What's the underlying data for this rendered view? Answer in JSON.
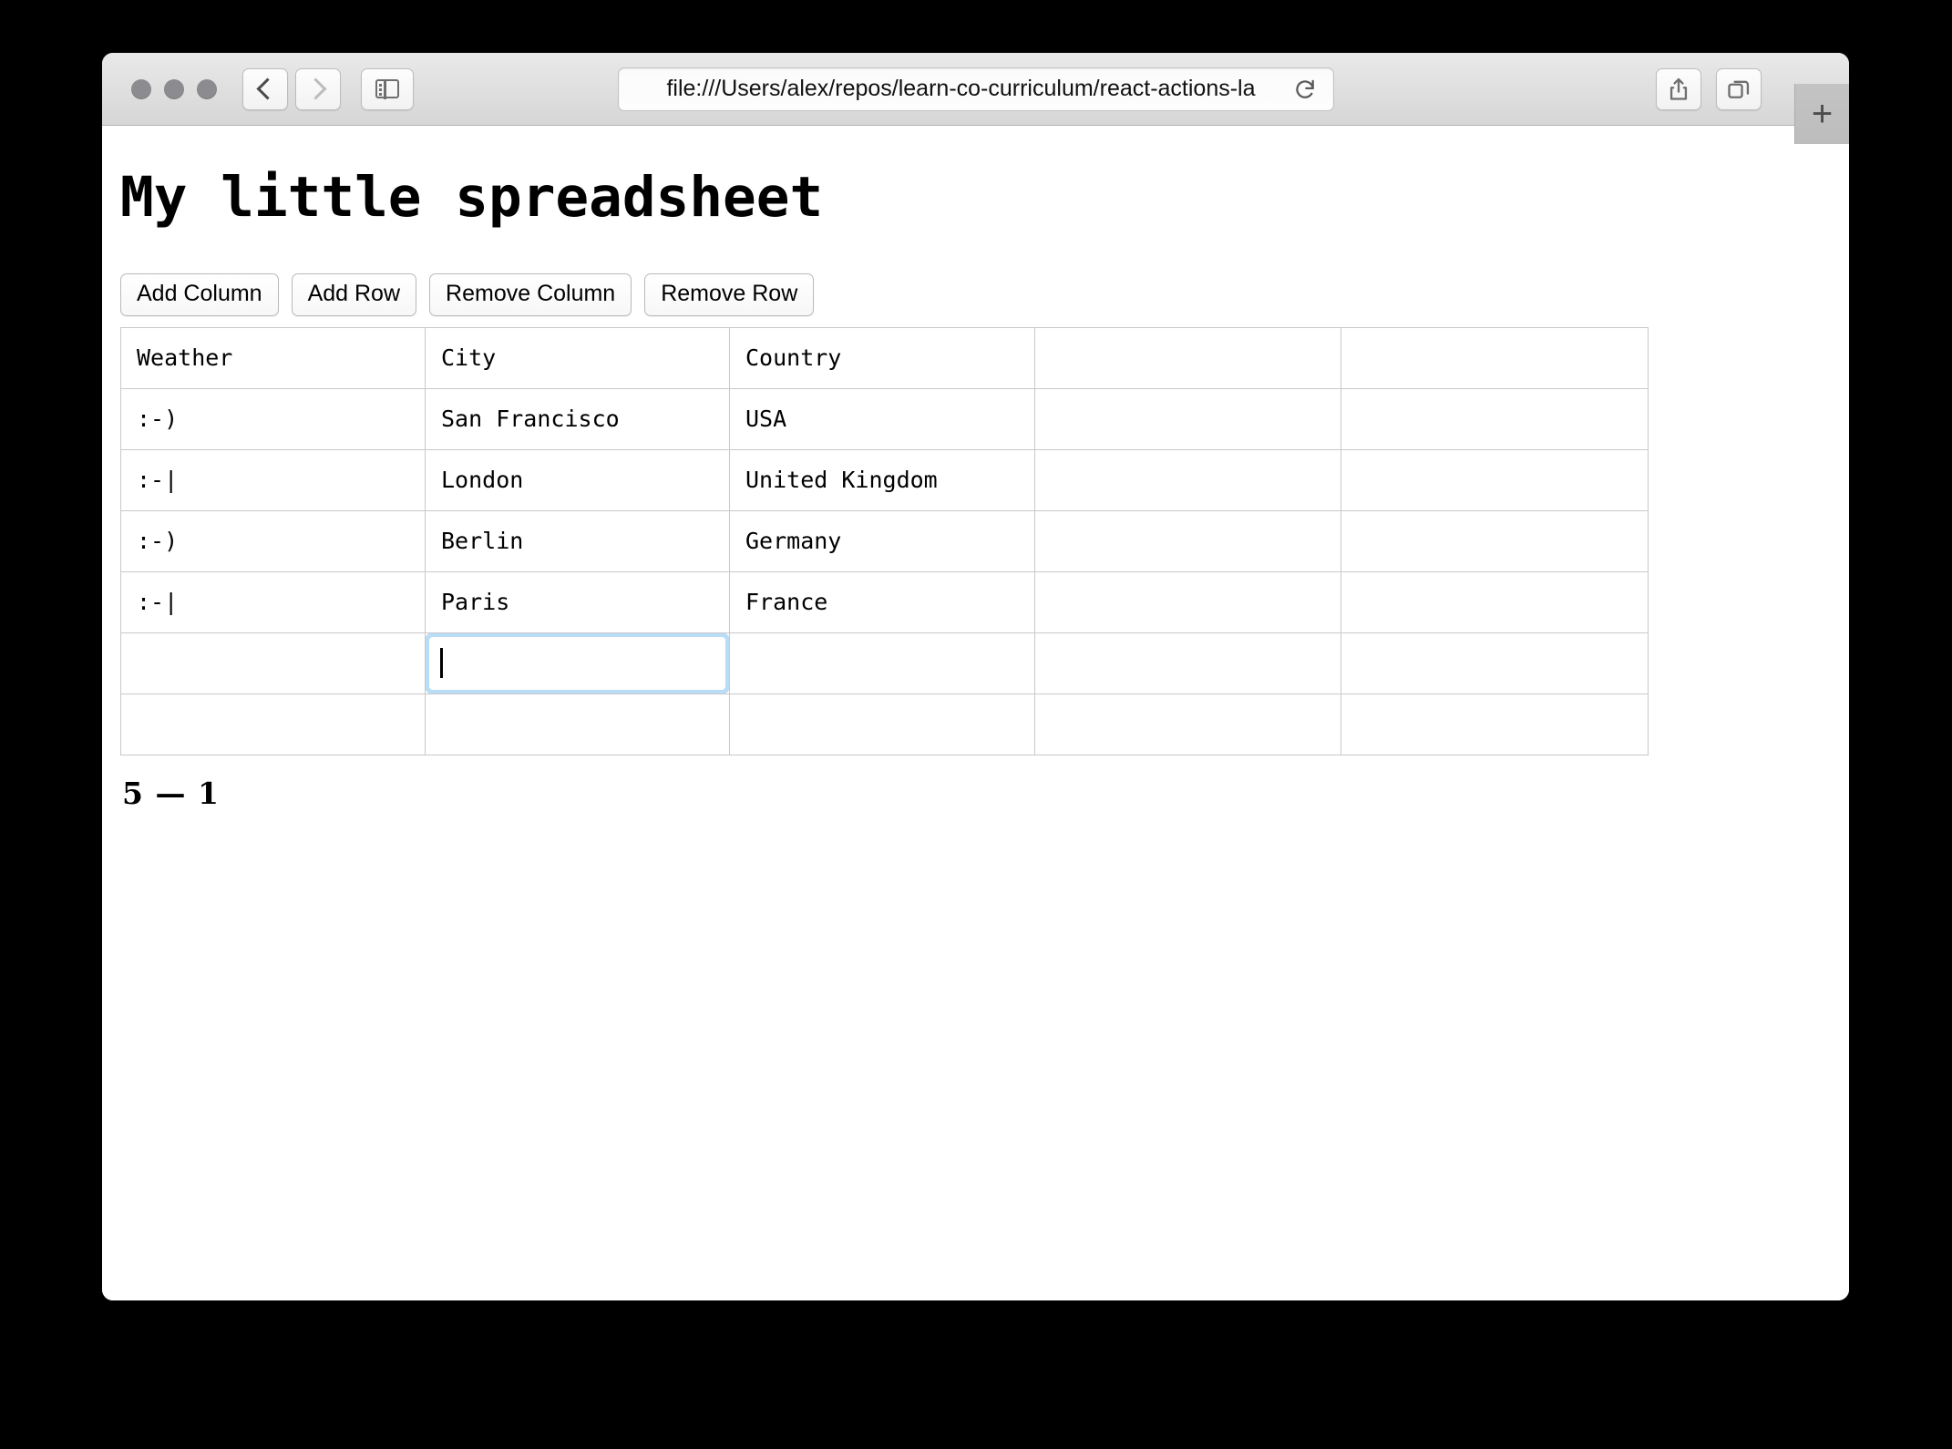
{
  "browser": {
    "url": "file:///Users/alex/repos/learn-co-curriculum/react-actions-la",
    "back_label": "Back",
    "forward_label": "Forward",
    "sidebar_label": "Show Sidebar",
    "reload_label": "Reload",
    "share_label": "Share",
    "tabs_label": "Show Tab Overview",
    "new_tab_label": "+",
    "traffic": {
      "close_label": "Close",
      "minimize_label": "Minimize",
      "zoom_label": "Zoom",
      "color": "#8c8c90"
    }
  },
  "page": {
    "title": "My little spreadsheet",
    "status": "5 — 1",
    "buttons": [
      {
        "label": "Add Column"
      },
      {
        "label": "Add Row"
      },
      {
        "label": "Remove Column"
      },
      {
        "label": "Remove Row"
      }
    ],
    "table": {
      "focus_color": "#b9dcf7",
      "focused_cell": {
        "row": 5,
        "col": 1,
        "value": ""
      },
      "rows": [
        [
          "Weather",
          "City",
          "Country",
          "",
          ""
        ],
        [
          ":-)",
          "San Francisco",
          "USA",
          "",
          ""
        ],
        [
          ":-|",
          "London",
          "United Kingdom",
          "",
          ""
        ],
        [
          ":-)",
          "Berlin",
          "Germany",
          "",
          ""
        ],
        [
          ":-|",
          "Paris",
          "France",
          "",
          ""
        ],
        [
          "",
          "",
          "",
          "",
          ""
        ],
        [
          "",
          "",
          "",
          "",
          ""
        ]
      ]
    }
  }
}
